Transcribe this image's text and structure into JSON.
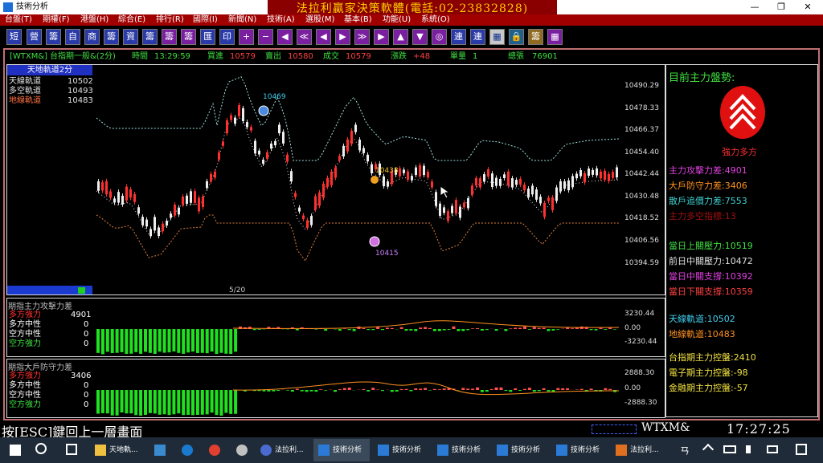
{
  "window": {
    "title": "技術分析",
    "minimize": "—",
    "maximize": "❐",
    "close": "✕"
  },
  "brand": "法拉利贏家決策軟體(電話:02-23832828)",
  "menu": [
    "台盤(T)",
    "期權(F)",
    "港盤(H)",
    "綜合(E)",
    "排行(R)",
    "國際(I)",
    "新聞(N)",
    "技術(A)",
    "選股(M)",
    "基本(B)",
    "功能(U)",
    "系統(O)"
  ],
  "toolbar": [
    "短",
    "營",
    "籌",
    "自",
    "商",
    "籌",
    "資",
    "籌",
    "籌",
    "籌",
    "匯",
    "印",
    "+",
    "−",
    "◀",
    "≪",
    "◀",
    "▶",
    "≫",
    "▶",
    "▲",
    "▼",
    "◎",
    "連",
    "連",
    "▦",
    "🔒",
    "籌",
    "▦"
  ],
  "info": {
    "code": "[WTXM&]",
    "name": "台指期一般&(2分)",
    "time_label": "時間",
    "time": "13:29:59",
    "bid_label": "買進",
    "bid": "10579",
    "ask_label": "賣出",
    "ask": "10580",
    "deal_label": "成交",
    "deal": "10579",
    "change_label": "漲跌",
    "change": "+48",
    "vol_label": "單量",
    "vol": "1",
    "total_label": "總張",
    "total": "76901"
  },
  "main": {
    "tab": "天地軌道2分",
    "legend": [
      {
        "name": "天線軌道",
        "value": "10502"
      },
      {
        "name": "多空軌道",
        "value": "10493"
      },
      {
        "name": "地線軌道",
        "value": "10483"
      }
    ],
    "yticks": [
      "10490.29",
      "10478.33",
      "10466.37",
      "10454.40",
      "10442.44",
      "10430.48",
      "10418.52",
      "10406.56",
      "10394.59"
    ],
    "date": "5/20",
    "labels": {
      "high": "10469",
      "mid": "10438",
      "low": "10415"
    }
  },
  "sub1": {
    "title": "期指主力攻擊力差",
    "legend": [
      {
        "name": "多方強力",
        "value": "4901"
      },
      {
        "name": "多方中性",
        "value": "0"
      },
      {
        "name": "空方中性",
        "value": "0"
      },
      {
        "name": "空方強力",
        "value": "0"
      }
    ],
    "yticks": [
      "3230.44",
      "0.00",
      "-3230.44"
    ]
  },
  "sub2": {
    "title": "期指大戶防守力差",
    "legend": [
      {
        "name": "多方強力",
        "value": "3406"
      },
      {
        "name": "多方中性",
        "value": "0"
      },
      {
        "name": "空方中性",
        "value": "0"
      },
      {
        "name": "空方強力",
        "value": "0"
      }
    ],
    "yticks": [
      "2888.30",
      "0.00",
      "-2888.30"
    ]
  },
  "side": {
    "title": "目前主力盤勢:",
    "trend": "強力多方",
    "metrics": [
      {
        "label": "主力攻擊力差",
        "value": "4901",
        "color": "#e040e0"
      },
      {
        "label": "大戶防守力差",
        "value": "3406",
        "color": "#ff9020"
      },
      {
        "label": "散戶追價力差",
        "value": "7553",
        "color": "#40d0d0"
      },
      {
        "label": "主力多空指標",
        "value": "13",
        "color": "#a01010"
      }
    ],
    "levels": [
      {
        "label": "當日上關壓力",
        "value": "10519",
        "color": "#40e040"
      },
      {
        "label": "前日中關壓力",
        "value": "10472",
        "color": "#e0e0e0"
      },
      {
        "label": "當日中關支撐",
        "value": "10392",
        "color": "#e040e0"
      },
      {
        "label": "當日下關支撐",
        "value": "10359",
        "color": "#ff4040"
      }
    ],
    "tracks": [
      {
        "label": "天線軌道",
        "value": "10502",
        "color": "#40d0f0"
      },
      {
        "label": "地線軌道",
        "value": "10483",
        "color": "#ff9020"
      }
    ],
    "pull": [
      {
        "label": "台指期主力控盤",
        "value": "2410",
        "color": "#f0e040"
      },
      {
        "label": "電子期主力控盤",
        "value": "-98",
        "color": "#f0e040"
      },
      {
        "label": "金融期主力控盤",
        "value": "-57",
        "color": "#f0e040"
      }
    ]
  },
  "status": {
    "esc": "按[ESC]鍵回上一層畫面",
    "code": "WTXM&",
    "clock": "17:27:25"
  },
  "taskbar": {
    "items": [
      "天地軌...",
      "",
      "",
      "",
      "",
      "法拉利...",
      "技術分析",
      "技術分析",
      "技術分析",
      "技術分析",
      "技術分析",
      "法拉利..."
    ],
    "tray": "ㄢ"
  },
  "colors": {
    "up": "#ff3030",
    "down": "#ffffff",
    "bull": "#20e020",
    "menu": "#a00000"
  }
}
